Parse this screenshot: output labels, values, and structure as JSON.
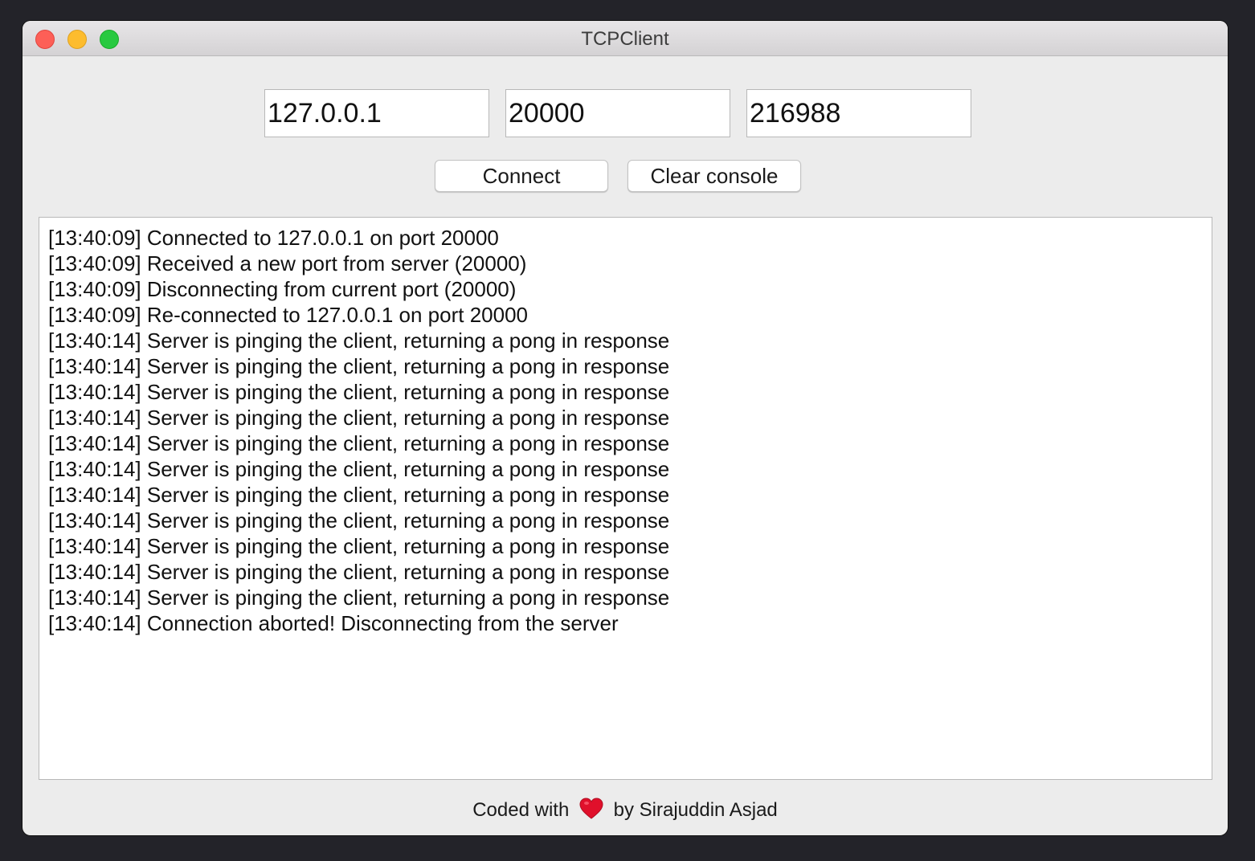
{
  "window": {
    "title": "TCPClient"
  },
  "inputs": {
    "host": "127.0.0.1",
    "port": "20000",
    "client_id": "216988"
  },
  "buttons": {
    "connect": "Connect",
    "clear_console": "Clear console"
  },
  "console": {
    "lines": [
      "[13:40:09] Connected to 127.0.0.1 on port 20000",
      "[13:40:09] Received a new port from server (20000)",
      "[13:40:09] Disconnecting from current port (20000)",
      "[13:40:09] Re-connected to 127.0.0.1 on port 20000",
      "[13:40:14] Server is pinging the client, returning a pong in response",
      "[13:40:14] Server is pinging the client, returning a pong in response",
      "[13:40:14] Server is pinging the client, returning a pong in response",
      "[13:40:14] Server is pinging the client, returning a pong in response",
      "[13:40:14] Server is pinging the client, returning a pong in response",
      "[13:40:14] Server is pinging the client, returning a pong in response",
      "[13:40:14] Server is pinging the client, returning a pong in response",
      "[13:40:14] Server is pinging the client, returning a pong in response",
      "[13:40:14] Server is pinging the client, returning a pong in response",
      "[13:40:14] Server is pinging the client, returning a pong in response",
      "[13:40:14] Server is pinging the client, returning a pong in response",
      "[13:40:14] Connection aborted! Disconnecting from the server"
    ]
  },
  "footer": {
    "prefix": "Coded with",
    "heart_icon": "heart-icon",
    "suffix": "by Sirajuddin Asjad"
  },
  "colors": {
    "close": "#fd5f57",
    "minimize": "#fdbc2e",
    "maximize": "#28c940",
    "heart": "#e0102b"
  }
}
